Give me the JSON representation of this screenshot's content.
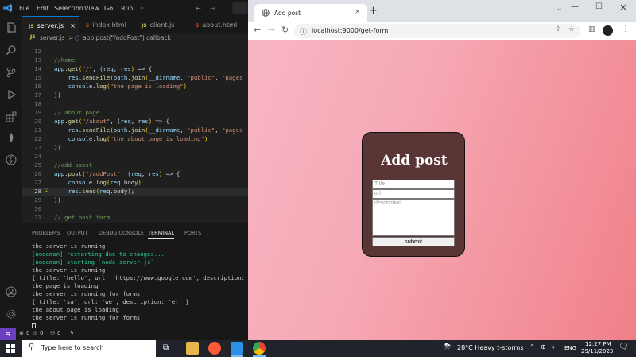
{
  "vscode": {
    "menu": [
      "File",
      "Edit",
      "Selection",
      "View",
      "Go",
      "Run"
    ],
    "tabs": [
      {
        "icon": "JS",
        "label": "server.js",
        "close": "×"
      },
      {
        "icon": "5",
        "label": "index.html"
      },
      {
        "icon": "JS",
        "label": "client.js"
      },
      {
        "icon": "5",
        "label": "about.html"
      }
    ],
    "breadcrumb": {
      "file": "server.js",
      "sep": ">",
      "symbol": "app.post(\"/addPost\") callback"
    },
    "lines": [
      {
        "n": "12",
        "t": ""
      },
      {
        "n": "13",
        "t": "//home"
      },
      {
        "n": "14",
        "t": "app.get(\"/\", (req, res) => {"
      },
      {
        "n": "15",
        "t": "    res.sendFile(path.join(__dirname, \"public\", \"pages"
      },
      {
        "n": "16",
        "t": "    console.log(\"the page is loading\")"
      },
      {
        "n": "17",
        "t": "})"
      },
      {
        "n": "18",
        "t": ""
      },
      {
        "n": "19",
        "t": "// about page"
      },
      {
        "n": "20",
        "t": "app.get(\"/about\", (req, res) => {"
      },
      {
        "n": "21",
        "t": "    res.sendFile(path.join(__dirname, \"public\", \"pages"
      },
      {
        "n": "22",
        "t": "    console.log(\"the about page is loading\")"
      },
      {
        "n": "23",
        "t": "})"
      },
      {
        "n": "24",
        "t": ""
      },
      {
        "n": "25",
        "t": "//add apost"
      },
      {
        "n": "26",
        "t": "app.post(\"/addPost\", (req, res) => {"
      },
      {
        "n": "27",
        "t": "    console.log(req.body)"
      },
      {
        "n": "28",
        "t": "    res.send(req.body);"
      },
      {
        "n": "29",
        "t": "})"
      },
      {
        "n": "30",
        "t": ""
      },
      {
        "n": "31",
        "t": "// get post form"
      }
    ],
    "panel_tabs": [
      "PROBLEMS",
      "OUTPUT",
      "DEBUG CONSOLE",
      "TERMINAL",
      "PORTS"
    ],
    "terminal": [
      {
        "t": "the server is running",
        "g": false
      },
      {
        "t": "[nodemon] restarting due to changes...",
        "g": true
      },
      {
        "t": "[nodemon] starting `node server.js`",
        "g": true
      },
      {
        "t": "the server is running",
        "g": false
      },
      {
        "t": "{ title: 'hello', url: 'https://www.google.com', description: 'Hel",
        "g": false
      },
      {
        "t": "the page is loading",
        "g": false
      },
      {
        "t": "the server is running for forms",
        "g": false
      },
      {
        "t": "{ title: 'sa', url: 'we', description: 'er' }",
        "g": false
      },
      {
        "t": "the about page is loading",
        "g": false
      },
      {
        "t": "the server is running for forms",
        "g": false
      }
    ],
    "status": {
      "errors": "0",
      "warnings": "0",
      "ports": "0"
    }
  },
  "chrome": {
    "tab_title": "Add post",
    "url": "localhost:9000/get-form",
    "page": {
      "heading": "Add post",
      "title_placeholder": "Title",
      "url_placeholder": "url",
      "description_placeholder": "description",
      "submit_label": "submit"
    }
  },
  "taskbar": {
    "search_placeholder": "Type here to search",
    "weather": "28°C  Heavy t-storms",
    "lang": "ENG",
    "time": "12:27 PM",
    "date": "29/11/2023"
  }
}
